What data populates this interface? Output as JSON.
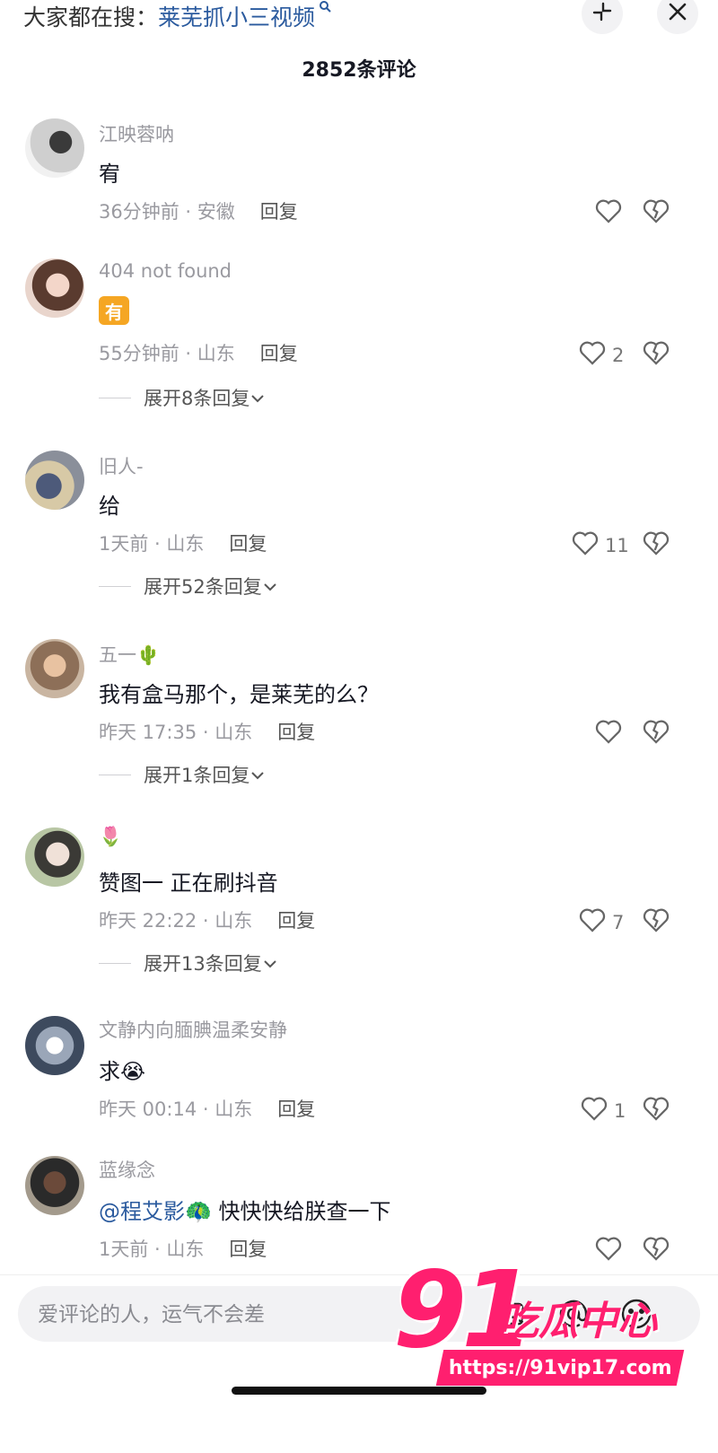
{
  "header": {
    "search_prefix": "大家都在搜：",
    "search_query": "莱芜抓小三视频",
    "comment_count_title": "2852条评论"
  },
  "comments": [
    {
      "name": "江映蓉呐",
      "text": "宥",
      "time_location": "36分钟前 · 安徽",
      "reply_label": "回复",
      "likes": ""
    },
    {
      "name": "404 not found",
      "text": "有",
      "time_location": "55分钟前 · 山东",
      "reply_label": "回复",
      "likes": "2",
      "expand_label": "展开8条回复"
    },
    {
      "name": "旧人-",
      "text": "给",
      "time_location": "1天前 · 山东",
      "reply_label": "回复",
      "likes": "11",
      "expand_label": "展开52条回复"
    },
    {
      "name": "五一🌵",
      "text": "我有盒马那个，是莱芜的么？",
      "time_location": "昨天 17:35 · 山东",
      "reply_label": "回复",
      "likes": "",
      "expand_label": "展开1条回复"
    },
    {
      "name": "🌷",
      "text": "赞图一  正在刷抖音",
      "time_location": "昨天 22:22 · 山东",
      "reply_label": "回复",
      "likes": "7",
      "expand_label": "展开13条回复"
    },
    {
      "name": "文静内向腼腆温柔安静",
      "text": "求😭",
      "time_location": "昨天 00:14 · 山东",
      "reply_label": "回复",
      "likes": "1"
    },
    {
      "name": "蓝缘念",
      "mention": "@程艾影🦚",
      "text": " 快快快给朕查一下",
      "time_location": "1天前 · 山东",
      "reply_label": "回复",
      "likes": ""
    }
  ],
  "bottom": {
    "input_placeholder": "爱评论的人，运气不会差"
  },
  "watermark": {
    "number": "91",
    "name": "吃瓜中心",
    "url": "https://91vip17.com"
  },
  "icons": {
    "collapse": "collapse-icon",
    "close": "close-icon",
    "like": "heart-outline-icon",
    "dislike": "broken-heart-icon",
    "at": "at-icon",
    "emoji": "emoji-icon",
    "image": "image-icon",
    "search": "search-icon",
    "chevron": "chevron-down-icon"
  },
  "colors": {
    "link_blue": "#2a5a9e",
    "muted_text": "#9a9aa0",
    "watermark_pink": "#ff1f6f"
  }
}
